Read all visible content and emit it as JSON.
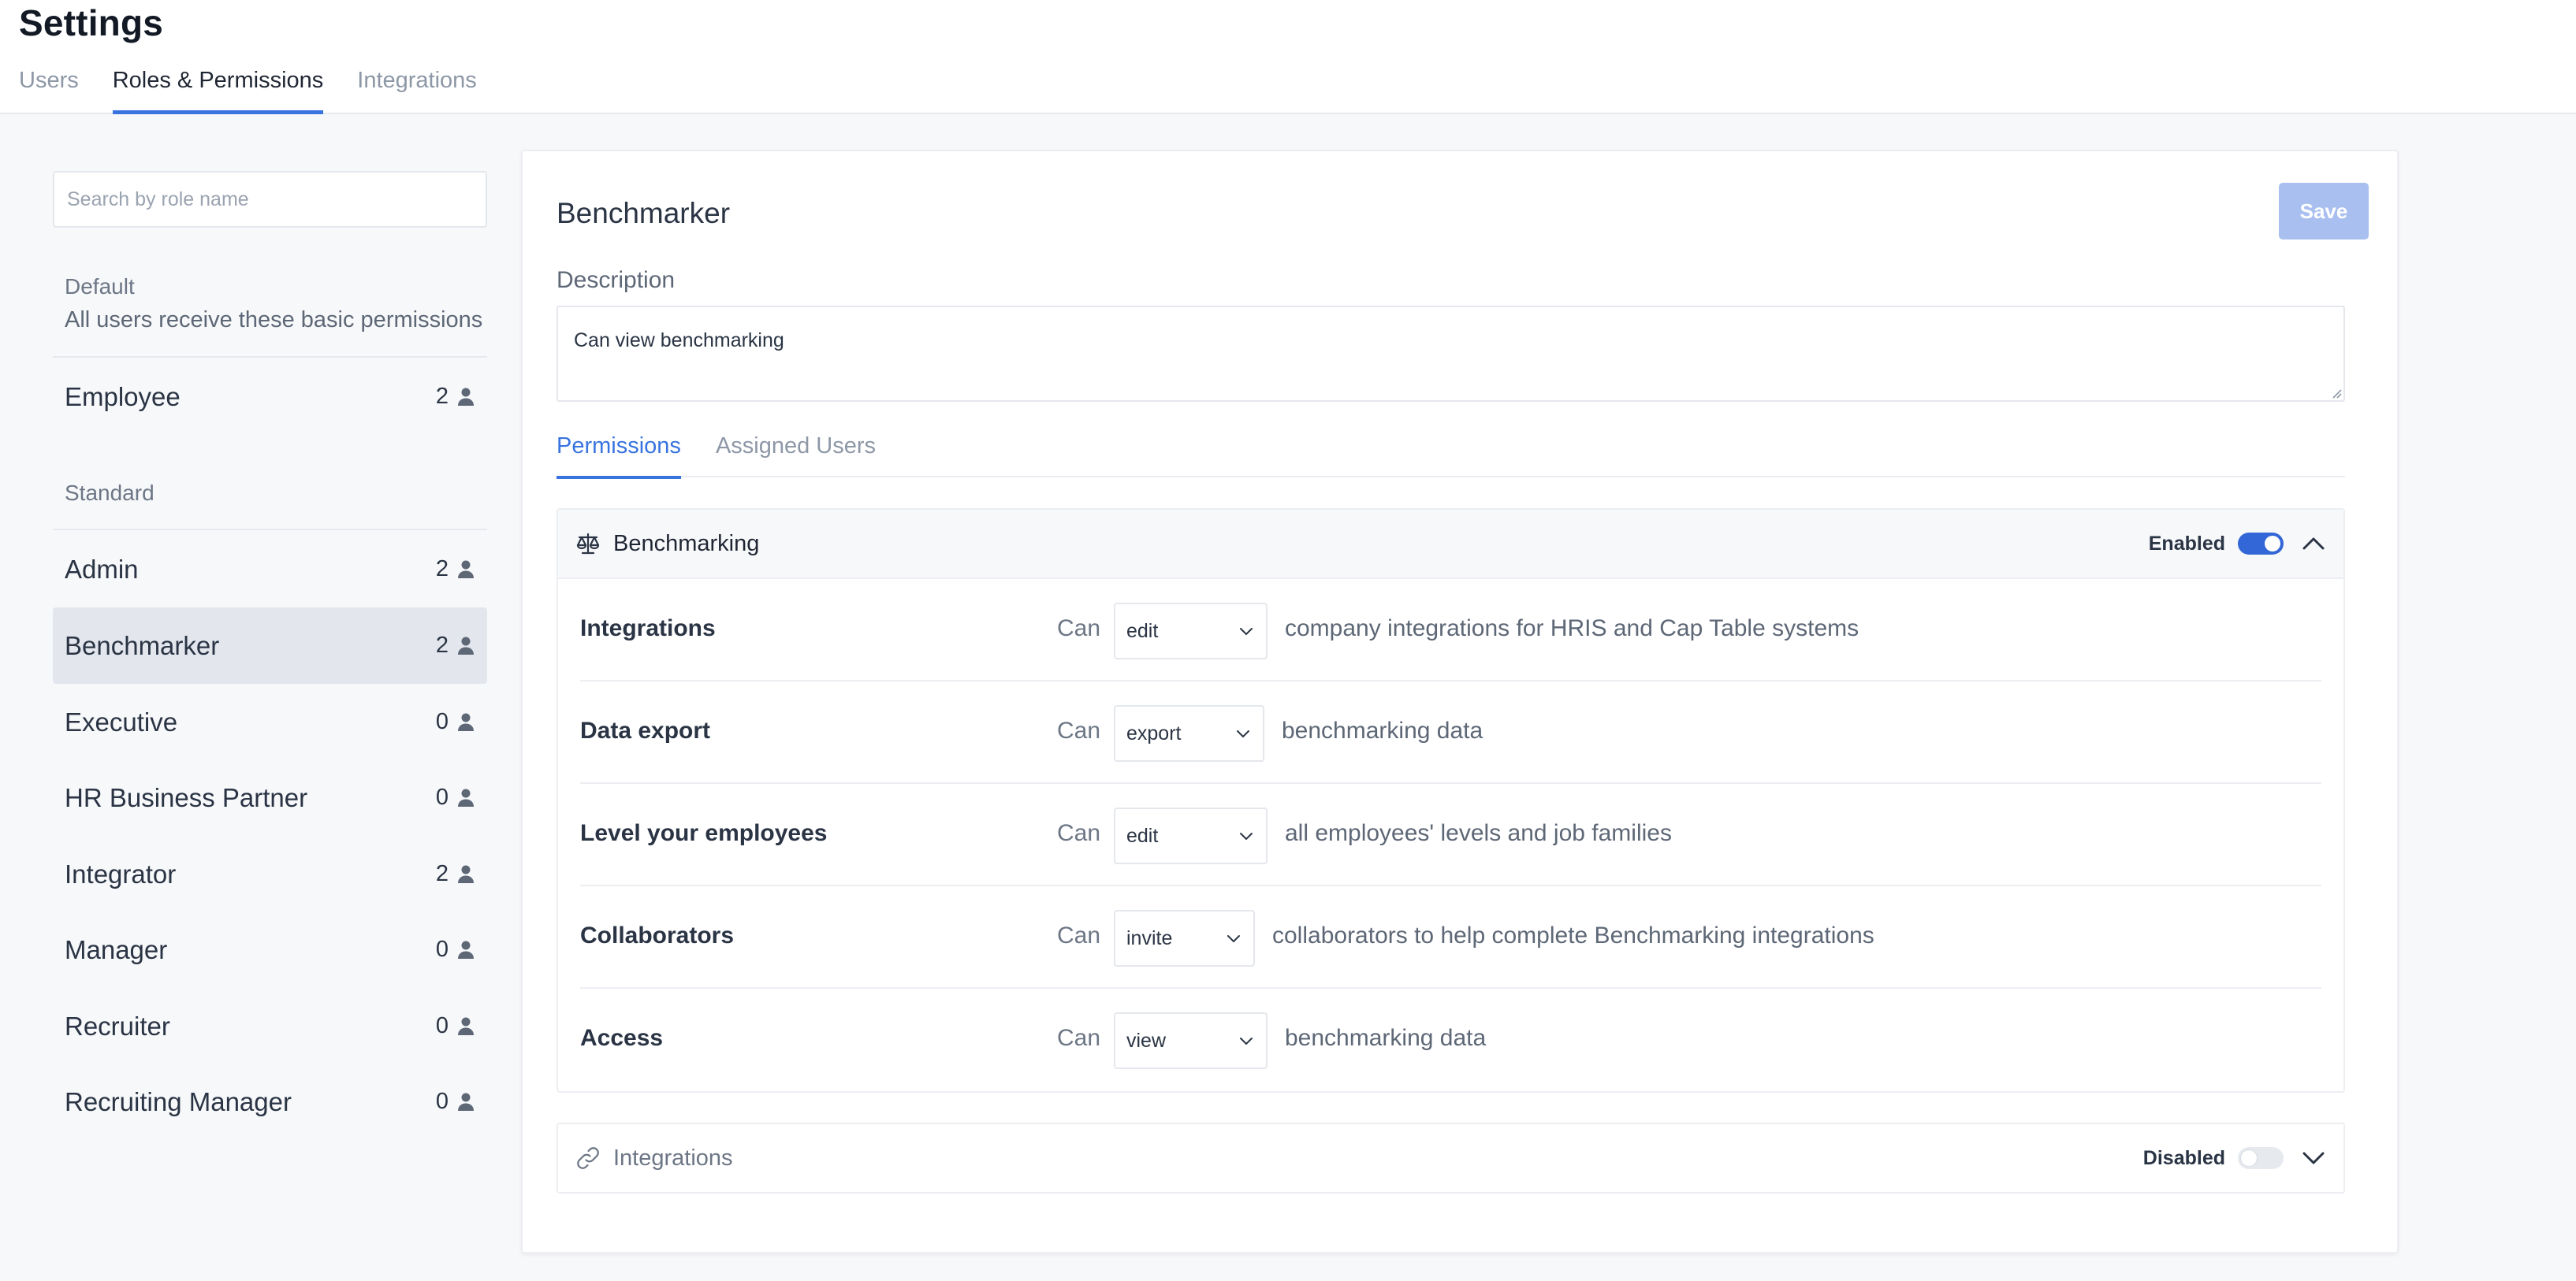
{
  "header": {
    "title": "Settings",
    "tabs": [
      {
        "label": "Users"
      },
      {
        "label": "Roles & Permissions"
      },
      {
        "label": "Integrations"
      }
    ]
  },
  "sidebar": {
    "search_placeholder": "Search by role name",
    "default_group": {
      "title": "Default",
      "subtitle": "All users receive these basic permissions",
      "roles": [
        {
          "name": "Employee",
          "count": "2"
        }
      ]
    },
    "standard_group": {
      "title": "Standard",
      "roles": [
        {
          "name": "Admin",
          "count": "2"
        },
        {
          "name": "Benchmarker",
          "count": "2"
        },
        {
          "name": "Executive",
          "count": "0"
        },
        {
          "name": "HR Business Partner",
          "count": "0"
        },
        {
          "name": "Integrator",
          "count": "2"
        },
        {
          "name": "Manager",
          "count": "0"
        },
        {
          "name": "Recruiter",
          "count": "0"
        },
        {
          "name": "Recruiting Manager",
          "count": "0"
        }
      ]
    },
    "selected_role": "Benchmarker"
  },
  "main": {
    "role_title": "Benchmarker",
    "save_label": "Save",
    "description_label": "Description",
    "description_value": "Can view benchmarking",
    "subtabs": [
      {
        "label": "Permissions"
      },
      {
        "label": "Assigned Users"
      }
    ],
    "sections": [
      {
        "title": "Benchmarking",
        "icon": "scale-icon",
        "state_label": "Enabled",
        "enabled": true,
        "expanded": true,
        "permissions": [
          {
            "name": "Integrations",
            "can": "Can",
            "action": "edit",
            "description": "company integrations for HRIS and Cap Table systems"
          },
          {
            "name": "Data export",
            "can": "Can",
            "action": "export",
            "description": "benchmarking data"
          },
          {
            "name": "Level your employees",
            "can": "Can",
            "action": "edit",
            "description": "all employees' levels and job families"
          },
          {
            "name": "Collaborators",
            "can": "Can",
            "action": "invite",
            "description": "collaborators to help complete Benchmarking integrations"
          },
          {
            "name": "Access",
            "can": "Can",
            "action": "view",
            "description": "benchmarking data"
          }
        ]
      },
      {
        "title": "Integrations",
        "icon": "link-icon",
        "state_label": "Disabled",
        "enabled": false,
        "expanded": false
      }
    ]
  },
  "colors": {
    "accent": "#3873e0",
    "toggle_on": "#3366d6",
    "save_disabled": "#a9bff0",
    "selected_row": "#e3e7ed",
    "background": "#f7f8fa"
  }
}
